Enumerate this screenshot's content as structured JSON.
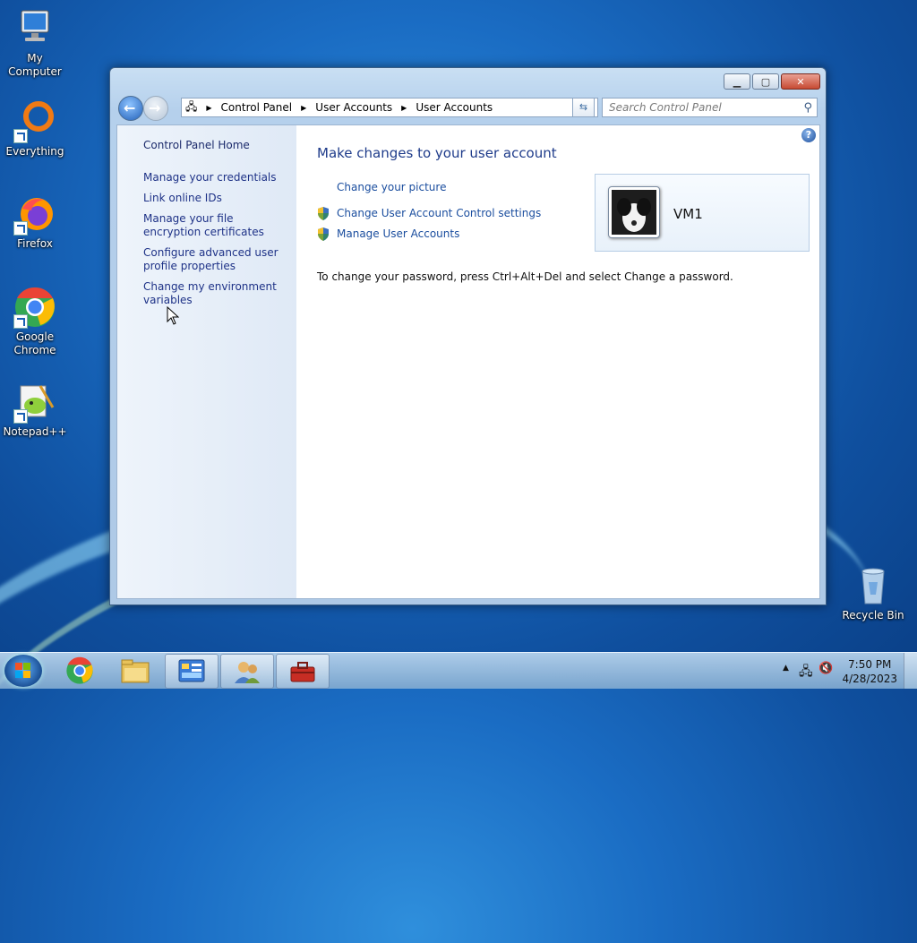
{
  "desktop": {
    "icons": [
      {
        "label": "My Computer"
      },
      {
        "label": "Everything"
      },
      {
        "label": "Firefox"
      },
      {
        "label": "Google Chrome"
      },
      {
        "label": "Notepad++"
      },
      {
        "label": "Recycle Bin"
      }
    ]
  },
  "window": {
    "breadcrumb": [
      "Control Panel",
      "User Accounts",
      "User Accounts"
    ],
    "search_placeholder": "Search Control Panel",
    "help_glyph": "?",
    "left_nav": [
      "Control Panel Home",
      "Manage your credentials",
      "Link online IDs",
      "Manage your file encryption certificates",
      "Configure advanced user profile properties",
      "Change my environment variables"
    ],
    "main": {
      "title": "Make changes to your user account",
      "links": [
        "Change your picture",
        "Change User Account Control settings",
        "Manage User Accounts"
      ],
      "password_note": "To change your password, press Ctrl+Alt+Del and select Change a password."
    },
    "user": {
      "name": "VM1"
    }
  },
  "taskbar": {
    "time": "7:50 PM",
    "date": "4/28/2023"
  },
  "colors": {
    "link": "#1a4d9e",
    "title": "#1e3b8a",
    "close_button": "#c74a33"
  }
}
